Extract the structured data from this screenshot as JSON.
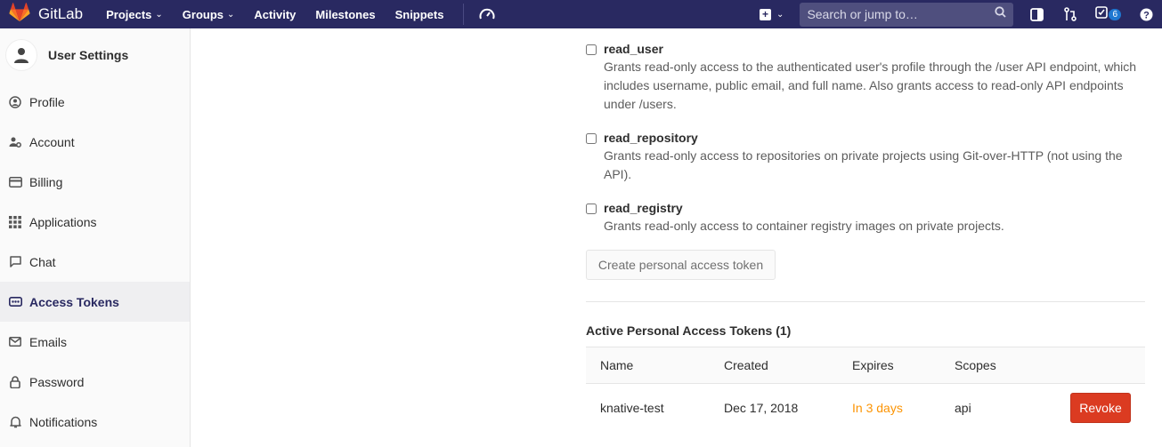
{
  "header": {
    "brand": "GitLab",
    "nav": [
      "Projects",
      "Groups",
      "Activity",
      "Milestones",
      "Snippets"
    ],
    "search_placeholder": "Search or jump to…",
    "todo_count": "6",
    "colors": {
      "navbar": "#292961",
      "brand_orange": "#e24329"
    }
  },
  "sidebar": {
    "title": "User Settings",
    "items": [
      {
        "label": "Profile",
        "icon": "profile-icon"
      },
      {
        "label": "Account",
        "icon": "account-icon"
      },
      {
        "label": "Billing",
        "icon": "billing-icon"
      },
      {
        "label": "Applications",
        "icon": "applications-icon"
      },
      {
        "label": "Chat",
        "icon": "chat-icon"
      },
      {
        "label": "Access Tokens",
        "icon": "access-tokens-icon",
        "active": true
      },
      {
        "label": "Emails",
        "icon": "emails-icon"
      },
      {
        "label": "Password",
        "icon": "lock-icon"
      },
      {
        "label": "Notifications",
        "icon": "bell-icon"
      }
    ]
  },
  "scopes": [
    {
      "name": "read_user",
      "desc": "Grants read-only access to the authenticated user's profile through the /user API endpoint, which includes username, public email, and full name. Also grants access to read-only API endpoints under /users."
    },
    {
      "name": "read_repository",
      "desc": "Grants read-only access to repositories on private projects using Git-over-HTTP (not using the API)."
    },
    {
      "name": "read_registry",
      "desc": "Grants read-only access to container registry images on private projects."
    }
  ],
  "create_button": "Create personal access token",
  "active_tokens": {
    "title": "Active Personal Access Tokens (1)",
    "columns": [
      "Name",
      "Created",
      "Expires",
      "Scopes"
    ],
    "rows": [
      {
        "name": "knative-test",
        "created": "Dec 17, 2018",
        "expires": "In 3 days",
        "scopes": "api",
        "action": "Revoke"
      }
    ]
  }
}
